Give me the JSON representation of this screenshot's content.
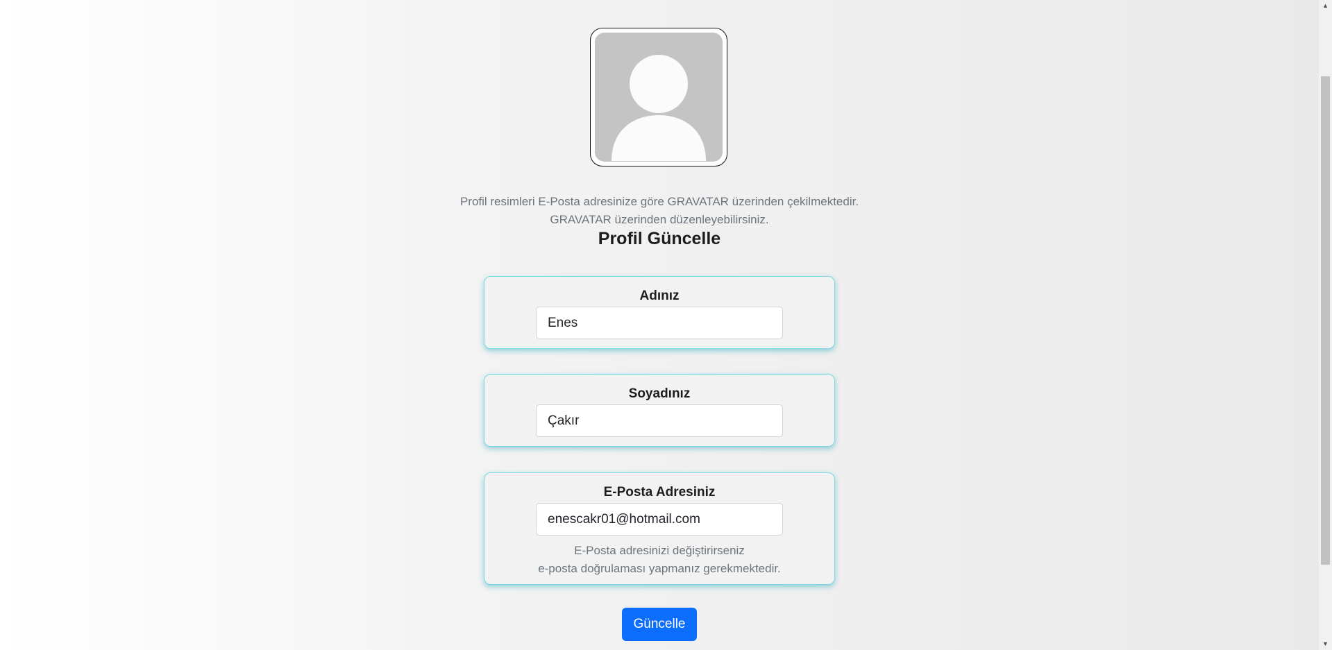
{
  "avatar": {
    "icon": "default-user-avatar-icon"
  },
  "info": {
    "line1": "Profil resimleri E-Posta adresinize göre GRAVATAR üzerinden çekilmektedir.",
    "line2": "GRAVATAR üzerinden düzenleyebilirsiniz."
  },
  "title": "Profil Güncelle",
  "form": {
    "first_name": {
      "label": "Adınız",
      "value": "Enes"
    },
    "last_name": {
      "label": "Soyadınız",
      "value": "Çakır"
    },
    "email": {
      "label": "E-Posta Adresiniz",
      "value": "enescakr01@hotmail.com",
      "help_line1": "E-Posta adresinizi değiştirirseniz",
      "help_line2": "e-posta doğrulaması yapmanız gerekmektedir."
    },
    "submit_label": "Güncelle"
  },
  "colors": {
    "primary": "#0d6efd",
    "card_border": "#7bd6e8",
    "muted_text": "#6c757d"
  }
}
